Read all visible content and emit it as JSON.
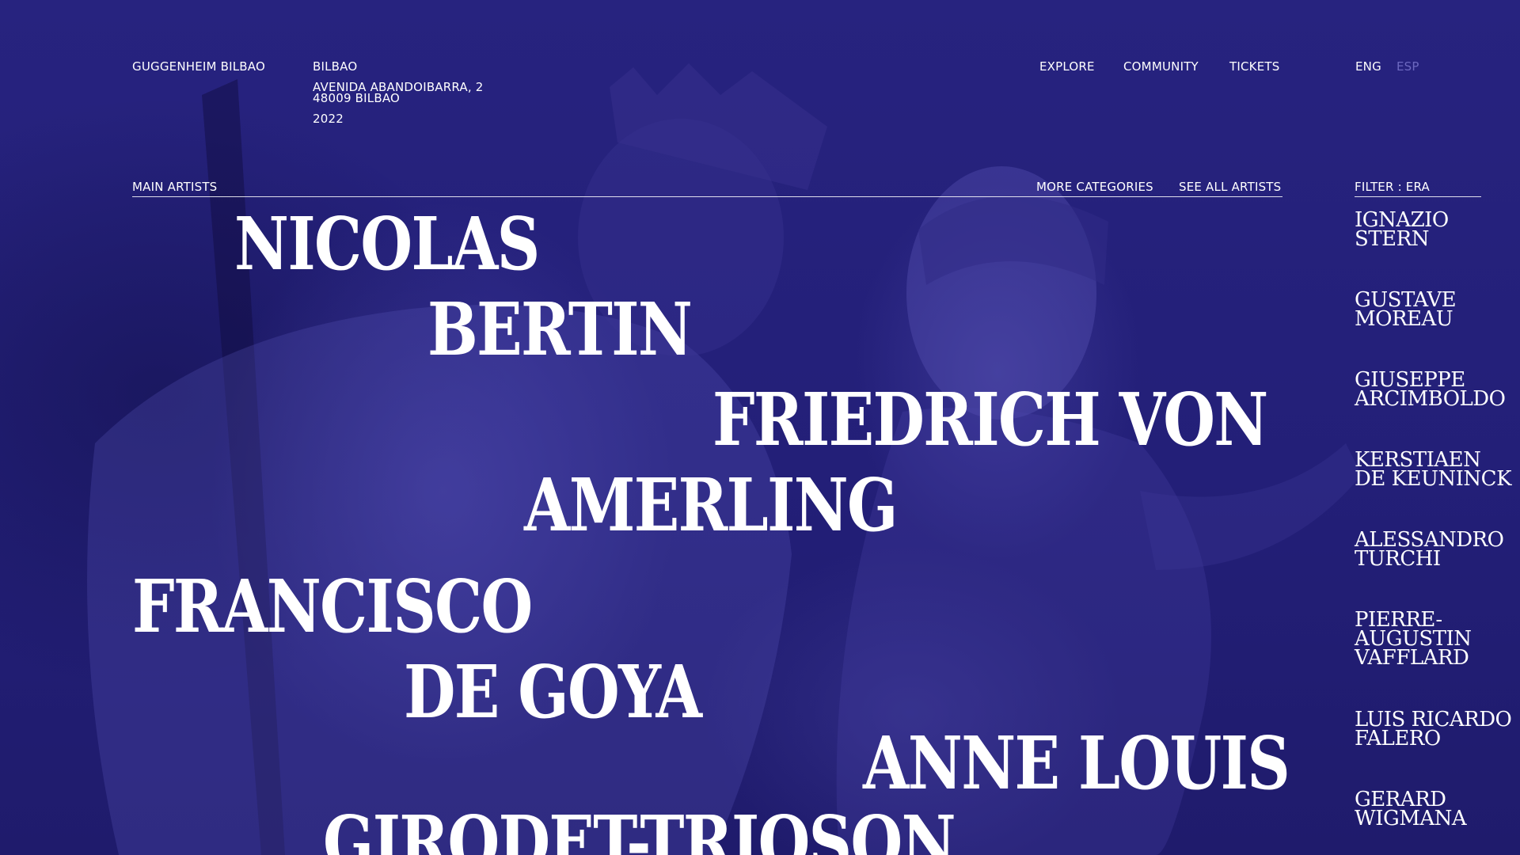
{
  "header": {
    "brand": "GUGGENHEIM BILBAO",
    "city": "BILBAO",
    "address_line1": "AVENIDA ABANDOIBARRA, 2",
    "address_line2": "48009 BILBAO",
    "year": "2022",
    "nav": [
      "EXPLORE",
      "COMMUNITY",
      "TICKETS"
    ],
    "languages": [
      {
        "label": "ENG",
        "active": true
      },
      {
        "label": "ESP",
        "active": false
      }
    ]
  },
  "section": {
    "title": "MAIN ARTISTS",
    "more_categories": "MORE CATEGORIES",
    "see_all": "SEE ALL ARTISTS"
  },
  "main_artists": [
    {
      "line1": "NICOLAS",
      "line2": "BERTIN"
    },
    {
      "line1": "FRIEDRICH VON",
      "line2": "AMERLING"
    },
    {
      "line1": "FRANCISCO",
      "line2": "DE GOYA"
    },
    {
      "line1": "ANNE LOUIS",
      "line2": "GIRODET-TRIOSON"
    }
  ],
  "filter": {
    "label": "FILTER : ERA",
    "artists": [
      {
        "line1": "IGNAZIO",
        "line2": "STERN"
      },
      {
        "line1": "GUSTAVE",
        "line2": "MOREAU"
      },
      {
        "line1": "GIUSEPPE",
        "line2": "ARCIMBOLDO"
      },
      {
        "line1": "KERSTIAEN",
        "line2": "DE KEUNINCK"
      },
      {
        "line1": "ALESSANDRO",
        "line2": "TURCHI"
      },
      {
        "line1": "PIERRE-",
        "line2": "AUGUSTIN",
        "line3": "VAFFLARD"
      },
      {
        "line1": "LUIS RICARDO",
        "line2": "FALERO"
      },
      {
        "line1": "GERARD",
        "line2": "WIGMANA"
      }
    ]
  },
  "colors": {
    "background": "#24217a",
    "text": "#ffffff",
    "inactive_language": "#6c68c0"
  }
}
